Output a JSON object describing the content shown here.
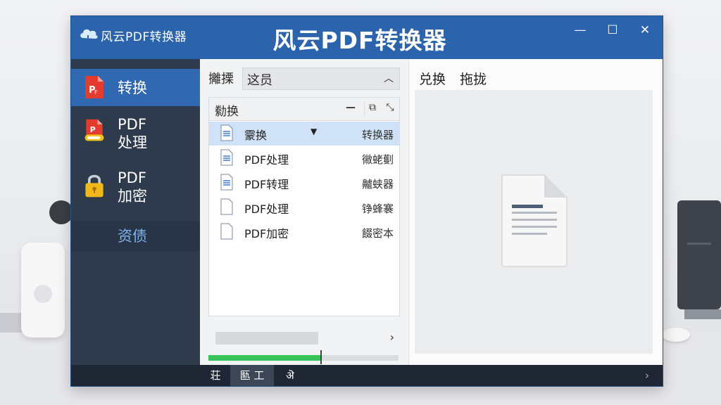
{
  "window": {
    "title_small": "风云PDF转换器",
    "title_big": "风云PDF转换器",
    "controls": [
      "—",
      "☐",
      "✕"
    ]
  },
  "sidebar": {
    "items": [
      {
        "label": "转换",
        "icon": "pdf-convert-icon",
        "active": true
      },
      {
        "label_line1": "PDF",
        "label_line2": "处理",
        "icon": "pdf-process-icon"
      },
      {
        "label_line1": "PDF",
        "label_line2": "加密",
        "icon": "lock-icon"
      },
      {
        "label": "资债"
      }
    ]
  },
  "middle": {
    "top_label": "攡搮",
    "dropdown_value": "这员",
    "list_header_label": "勬换",
    "rows": [
      {
        "name": "霥换",
        "type": "转换器",
        "selected": true
      },
      {
        "name": "PDF处理",
        "type": "幑蛯劐"
      },
      {
        "name": "PDF转理",
        "type": "齇蛱器"
      },
      {
        "name": "PDF处理",
        "type": "铮蜂褰"
      },
      {
        "name": "PDF加密",
        "type": "餟密本"
      }
    ],
    "progress": 0.59
  },
  "right": {
    "tabs": [
      "兑换",
      "拖拢"
    ]
  },
  "statusbar": {
    "btn1": "荘",
    "btn2": "匦 工",
    "btn3": "ऄ",
    "arrow": "›"
  },
  "colors": {
    "titlebar": "#2b64ad",
    "sidebar": "#2e3b4d",
    "sidebar_active": "#3168b2",
    "progress": "#36c45a",
    "selected_row": "#cfe2f8"
  }
}
